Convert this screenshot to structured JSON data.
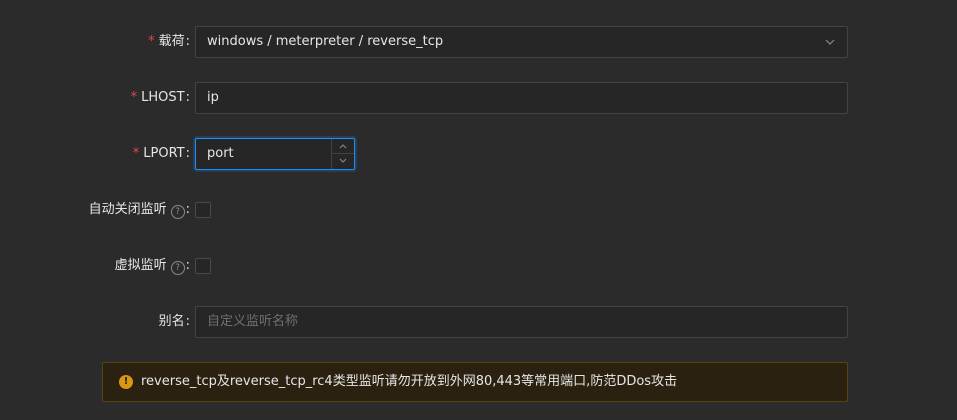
{
  "form": {
    "payload": {
      "label": "载荷",
      "required_mark": "*",
      "colon": ":",
      "selected": "windows / meterpreter / reverse_tcp"
    },
    "lhost": {
      "label": "LHOST",
      "required_mark": "*",
      "colon": ":",
      "value": "ip"
    },
    "lport": {
      "label": "LPORT",
      "required_mark": "*",
      "colon": ":",
      "value": "port"
    },
    "auto_close": {
      "label": "自动关闭监听",
      "help_glyph": "?",
      "colon": ":",
      "checked": false
    },
    "virtual": {
      "label": "虚拟监听",
      "help_glyph": "?",
      "colon": ":",
      "checked": false
    },
    "alias": {
      "label": "别名",
      "colon": ":",
      "placeholder": "自定义监听名称"
    }
  },
  "alert": {
    "icon_glyph": "!",
    "text": "reverse_tcp及reverse_tcp_rc4类型监听请勿开放到外网80,443等常用端口,防范DDos攻击"
  },
  "colors": {
    "background": "#2b2b2b",
    "required": "#e5484d",
    "focus_border": "#1890ff",
    "warning": "#d89614"
  },
  "icons": {
    "select_arrow": "chevron-down-icon",
    "help": "question-circle-icon",
    "warning": "exclamation-circle-icon"
  }
}
